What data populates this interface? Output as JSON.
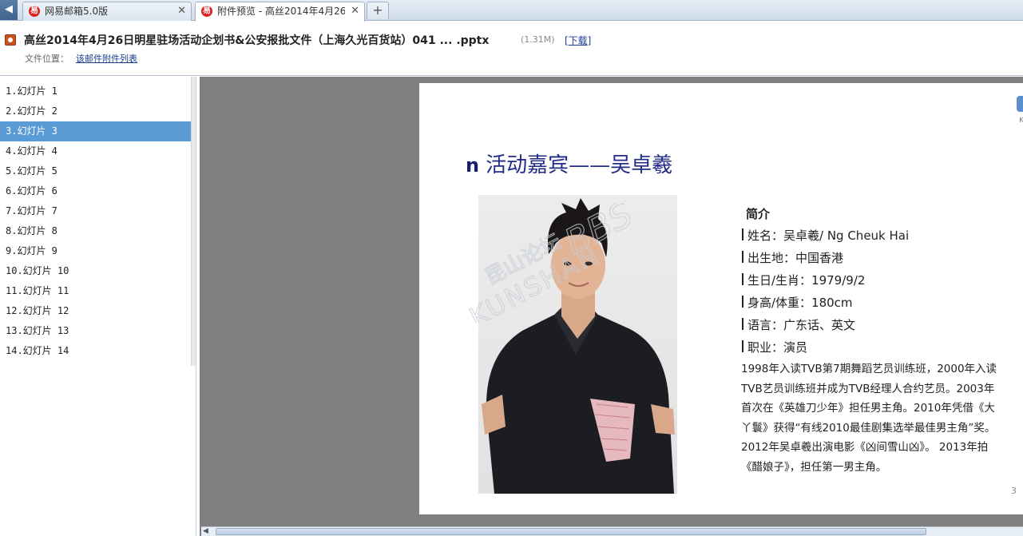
{
  "tabs": [
    {
      "label": "网易邮箱5.0版",
      "logo": "易",
      "active": false
    },
    {
      "label": "附件预览 - 高丝2014年4月26日",
      "logo": "易",
      "active": true
    }
  ],
  "tab_close": "✕",
  "tab_new": "+",
  "back_icon": "◀",
  "header": {
    "file_title": "高丝2014年4月26日明星驻场活动企划书&公安报批文件（上海久光百货站）041 ... .pptx",
    "file_size": "(1.31M)",
    "download_label": "[下载]",
    "location_label": "文件位置：",
    "location_link": "该邮件附件列表"
  },
  "slides": [
    "1.幻灯片 1",
    "2.幻灯片 2",
    "3.幻灯片 3",
    "4.幻灯片 4",
    "5.幻灯片 5",
    "6.幻灯片 6",
    "7.幻灯片 7",
    "8.幻灯片 8",
    "9.幻灯片 9",
    "10.幻灯片 10",
    "11.幻灯片 11",
    "12.幻灯片 12",
    "13.幻灯片 13",
    "14.幻灯片 14"
  ],
  "selected_slide": 2,
  "slide": {
    "title_bullet": "n",
    "title": "活动嘉宾——吴卓羲",
    "corner_letter": "K",
    "intro_heading": "简介",
    "info": [
      "姓名：吴卓羲/ Ng Cheuk Hai",
      "出生地：中国香港",
      "生日/生肖：1979/9/2",
      "身高/体重：180cm",
      "语言：广东话、英文",
      "职业：演员"
    ],
    "bio": "1998年入读TVB第7期舞蹈艺员训练班，2000年入读TVB艺员训练班并成为TVB经理人合约艺员。2003年首次在《英雄刀少年》担任男主角。2010年凭借《大丫鬟》获得“有线2010最佳剧集选举最佳男主角”奖。2012年吴卓羲出演电影《凶间雪山凶》。 2013年拍《醋娘子》，担任第一男主角。",
    "page_number": "3",
    "watermark_cn": "昆山论坛",
    "watermark_en": "KUNSHAN",
    "watermark_bbs": "BBS"
  },
  "colors": {
    "selected": "#5b9bd5",
    "title": "#222c88",
    "viewer_bg": "#808080",
    "link": "#1a3d8f"
  }
}
